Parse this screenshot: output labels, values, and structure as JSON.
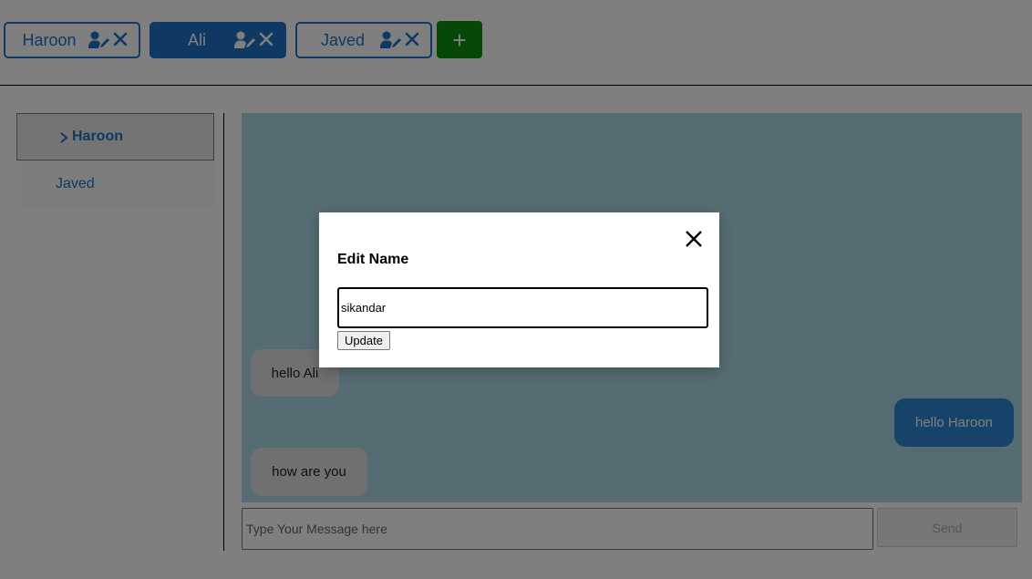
{
  "tabs": [
    {
      "label": "Haroon",
      "active": false
    },
    {
      "label": "Ali",
      "active": true
    },
    {
      "label": "Javed",
      "active": false
    }
  ],
  "add_button": {
    "label": "+"
  },
  "sidebar": {
    "items": [
      {
        "label": "Haroon",
        "active": true
      },
      {
        "label": "Javed",
        "active": false
      }
    ]
  },
  "chat": {
    "messages": [
      {
        "text": "hello Ali",
        "direction": "incoming"
      },
      {
        "text": "hello Haroon",
        "direction": "outgoing"
      },
      {
        "text": "how are you",
        "direction": "incoming"
      }
    ],
    "input_placeholder": "Type Your Message here",
    "send_label": "Send"
  },
  "modal": {
    "title": "Edit Name",
    "input_value": "sikandar",
    "update_label": "Update"
  },
  "colors": {
    "accent": "#1f73c7",
    "add_button": "#0e9112",
    "chat_background": "#add8e6",
    "outgoing_bubble": "#2f86d6",
    "incoming_bubble": "#e0e0e0"
  },
  "icons": {
    "tab_edit": "user-edit-icon",
    "tab_close": "close-icon",
    "sidebar_active": "chevron-right-icon",
    "modal_close": "close-icon"
  }
}
